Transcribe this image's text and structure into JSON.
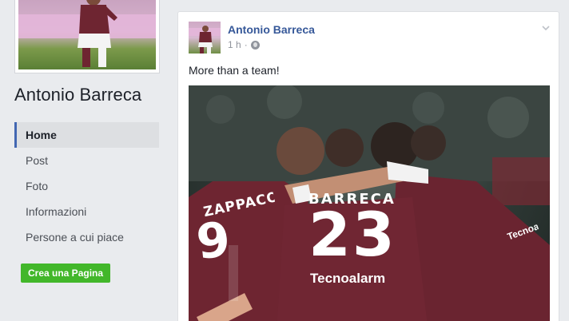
{
  "page": {
    "name": "Antonio Barreca"
  },
  "nav": {
    "items": [
      {
        "label": "Home",
        "active": true
      },
      {
        "label": "Post",
        "active": false
      },
      {
        "label": "Foto",
        "active": false
      },
      {
        "label": "Informazioni",
        "active": false
      },
      {
        "label": "Persone a cui piace",
        "active": false
      }
    ],
    "create_page_label": "Crea una Pagina"
  },
  "post": {
    "author": "Antonio Barreca",
    "time": "1 h",
    "separator": "·",
    "privacy_icon": "globe-icon",
    "text": "More than a team!",
    "photo": {
      "jersey_name": "BARRECA",
      "jersey_number": "23",
      "sponsor": "Tecnoalarm",
      "left_jersey_name": "ZAPPACOSTA",
      "left_jersey_number": "9",
      "right_sponsor": "Tecnoalarm"
    }
  },
  "colors": {
    "nav_active_border": "#4267b2",
    "author_link": "#365899",
    "create_button": "#42b72a",
    "jersey": "#6e2531"
  }
}
